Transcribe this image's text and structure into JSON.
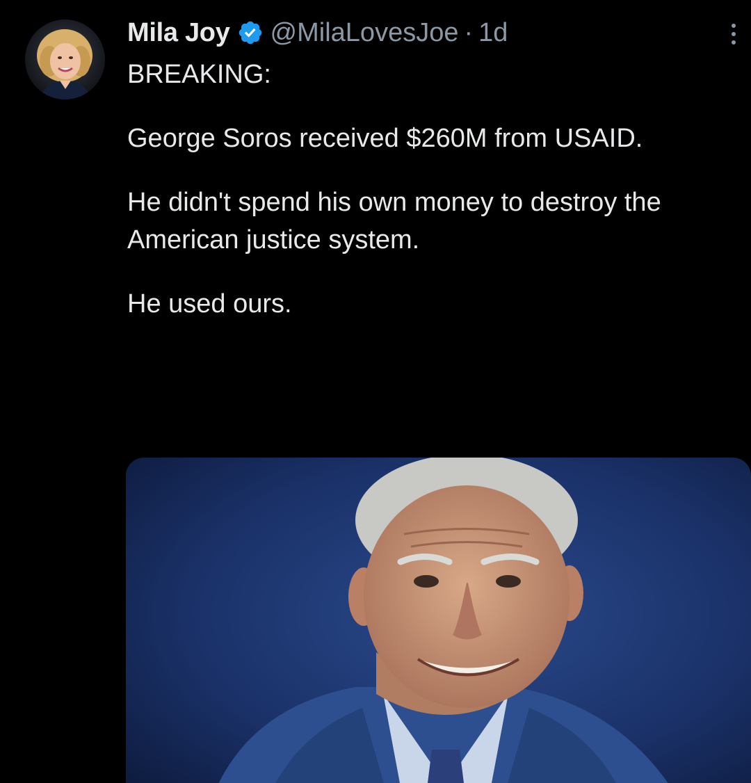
{
  "tweet": {
    "author": {
      "name": "Mila Joy",
      "handle": "@MilaLovesJoe",
      "verified": true,
      "avatar_alt": "profile photo of woman with curly blond hair"
    },
    "separator": "·",
    "timestamp": "1d",
    "text_lines": [
      "BREAKING:",
      "George Soros received $260M from USAID.",
      "He didn't spend his own money to destroy the American justice system.",
      "He used ours."
    ],
    "media": {
      "description": "photo of elderly man in suit smiling against dark blue background"
    }
  },
  "icons": {
    "verified": "verified-badge-icon",
    "more": "more-options-icon"
  },
  "colors": {
    "background": "#000000",
    "text_primary": "#e7e9ea",
    "text_secondary": "#8b98a5",
    "verified_blue": "#1d9bf0",
    "media_background": "#1c3468"
  }
}
